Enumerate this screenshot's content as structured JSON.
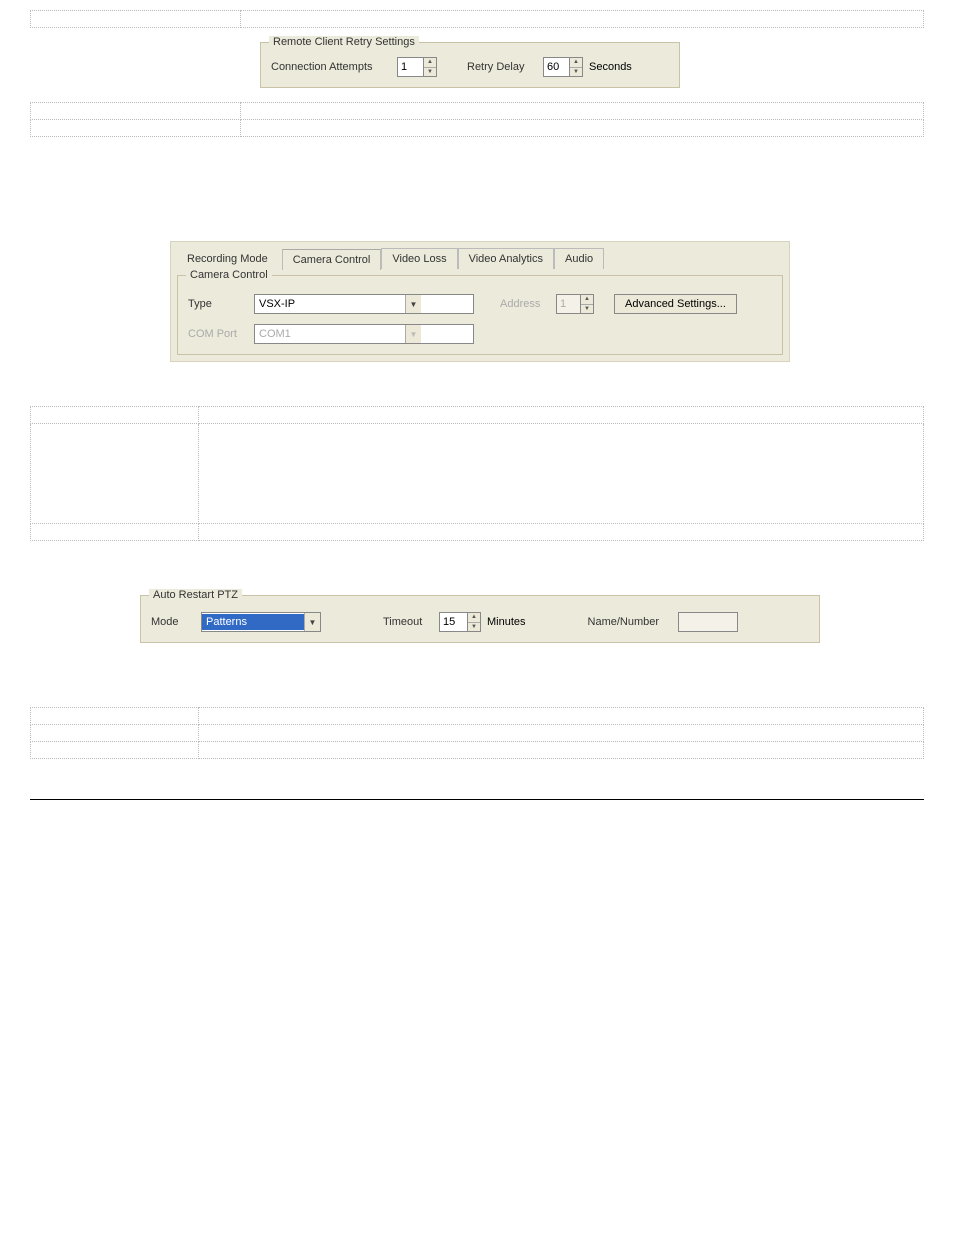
{
  "tables": {
    "t1": [
      {
        "left": "",
        "right": ""
      }
    ],
    "t2": [
      {
        "left": "",
        "right": ""
      },
      {
        "left": "",
        "right": ""
      }
    ],
    "t3": [
      {
        "left": "",
        "right": ""
      },
      {
        "left": "",
        "right": ""
      },
      {
        "left": "",
        "right": ""
      }
    ],
    "t4": [
      {
        "left": "",
        "right": ""
      },
      {
        "left": "",
        "right": ""
      },
      {
        "left": "",
        "right": ""
      }
    ]
  },
  "retry": {
    "legend": "Remote Client Retry Settings",
    "conn_attempts_label": "Connection Attempts",
    "conn_attempts_value": "1",
    "retry_delay_label": "Retry Delay",
    "retry_delay_value": "60",
    "seconds_label": "Seconds"
  },
  "cc": {
    "tabs": {
      "recording": "Recording Mode",
      "camera": "Camera Control",
      "video_loss": "Video Loss",
      "analytics": "Video Analytics",
      "audio": "Audio"
    },
    "legend": "Camera Control",
    "type_label": "Type",
    "type_value": "VSX-IP",
    "address_label": "Address",
    "address_value": "1",
    "advanced_label": "Advanced Settings...",
    "com_port_label": "COM Port",
    "com_port_value": "COM1"
  },
  "ptz": {
    "legend": "Auto Restart PTZ",
    "mode_label": "Mode",
    "mode_value": "Patterns",
    "timeout_label": "Timeout",
    "timeout_value": "15",
    "minutes_label": "Minutes",
    "name_number_label": "Name/Number",
    "name_number_value": ""
  }
}
